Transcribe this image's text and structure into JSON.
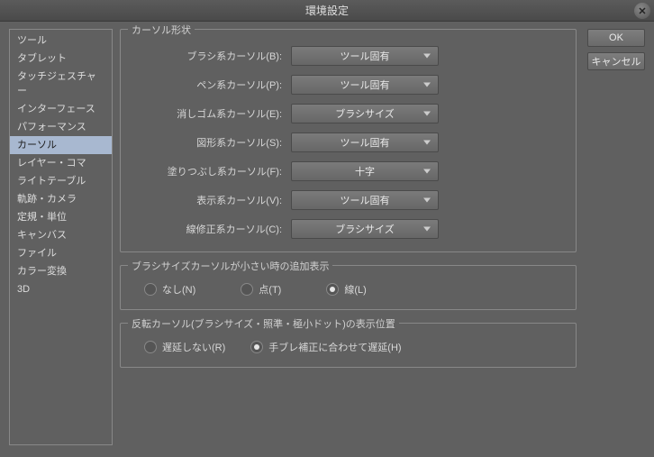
{
  "title": "環境設定",
  "buttons": {
    "ok": "OK",
    "cancel": "キャンセル"
  },
  "sidebar": {
    "items": [
      {
        "label": "ツール"
      },
      {
        "label": "タブレット"
      },
      {
        "label": "タッチジェスチャー"
      },
      {
        "label": "インターフェース"
      },
      {
        "label": "パフォーマンス"
      },
      {
        "label": "カーソル"
      },
      {
        "label": "レイヤー・コマ"
      },
      {
        "label": "ライトテーブル"
      },
      {
        "label": "軌跡・カメラ"
      },
      {
        "label": "定規・単位"
      },
      {
        "label": "キャンバス"
      },
      {
        "label": "ファイル"
      },
      {
        "label": "カラー変換"
      },
      {
        "label": "3D"
      }
    ],
    "selected_index": 5
  },
  "section_cursor_shape": {
    "legend": "カーソル形状",
    "rows": [
      {
        "label": "ブラシ系カーソル(B):",
        "value": "ツール固有"
      },
      {
        "label": "ペン系カーソル(P):",
        "value": "ツール固有"
      },
      {
        "label": "消しゴム系カーソル(E):",
        "value": "ブラシサイズ"
      },
      {
        "label": "図形系カーソル(S):",
        "value": "ツール固有"
      },
      {
        "label": "塗りつぶし系カーソル(F):",
        "value": "十字"
      },
      {
        "label": "表示系カーソル(V):",
        "value": "ツール固有"
      },
      {
        "label": "線修正系カーソル(C):",
        "value": "ブラシサイズ"
      }
    ]
  },
  "section_brush_small": {
    "legend": "ブラシサイズカーソルが小さい時の追加表示",
    "options": [
      {
        "label": "なし(N)"
      },
      {
        "label": "点(T)"
      },
      {
        "label": "線(L)"
      }
    ],
    "selected_index": 2
  },
  "section_invert": {
    "legend": "反転カーソル(ブラシサイズ・照準・極小ドット)の表示位置",
    "options": [
      {
        "label": "遅延しない(R)"
      },
      {
        "label": "手ブレ補正に合わせて遅延(H)"
      }
    ],
    "selected_index": 1
  }
}
